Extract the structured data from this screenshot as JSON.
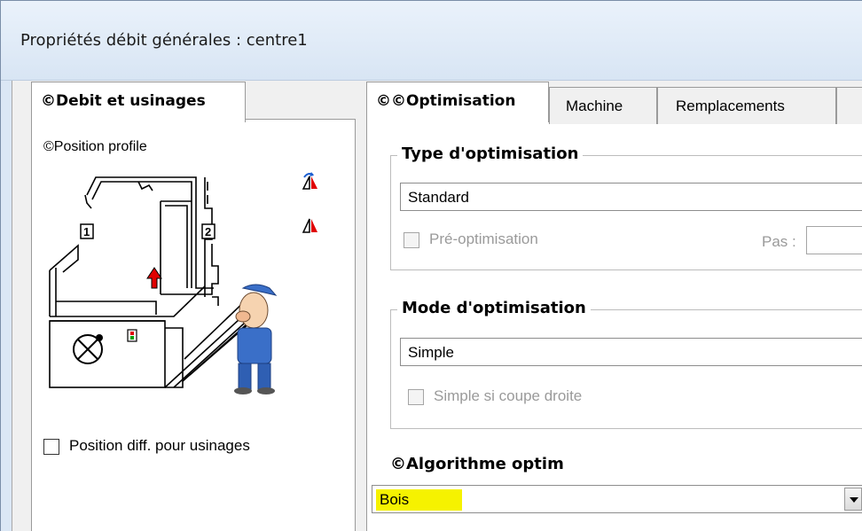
{
  "window": {
    "title": "Propriétés débit générales : centre1"
  },
  "left_tab": {
    "label": "©Debit et usinages"
  },
  "left_panel": {
    "position_label": "©Position profile",
    "diagram_labels": [
      "1",
      "2"
    ],
    "checkbox_label": "Position diff. pour usinages"
  },
  "right_tabs": [
    {
      "label": "©©Optimisation",
      "active": true
    },
    {
      "label": "Machine",
      "active": false
    },
    {
      "label": "Remplacements",
      "active": false
    }
  ],
  "type_group": {
    "title": "Type d'optimisation",
    "combo_value": "Standard",
    "preopt_label": "Pré-optimisation",
    "pas_label": "Pas :"
  },
  "mode_group": {
    "title": "Mode d'optimisation",
    "field_value": "Simple",
    "checkbox_label": "Simple si coupe droite"
  },
  "algo": {
    "title": "©Algorithme optim",
    "combo_value": "Bois",
    "highlight_color": "#f6f200"
  },
  "icons": [
    "flip-rotate-icon",
    "mirror-triangle-icon",
    "arrow-up-icon",
    "stop-circle-icon",
    "worker-illustration"
  ]
}
